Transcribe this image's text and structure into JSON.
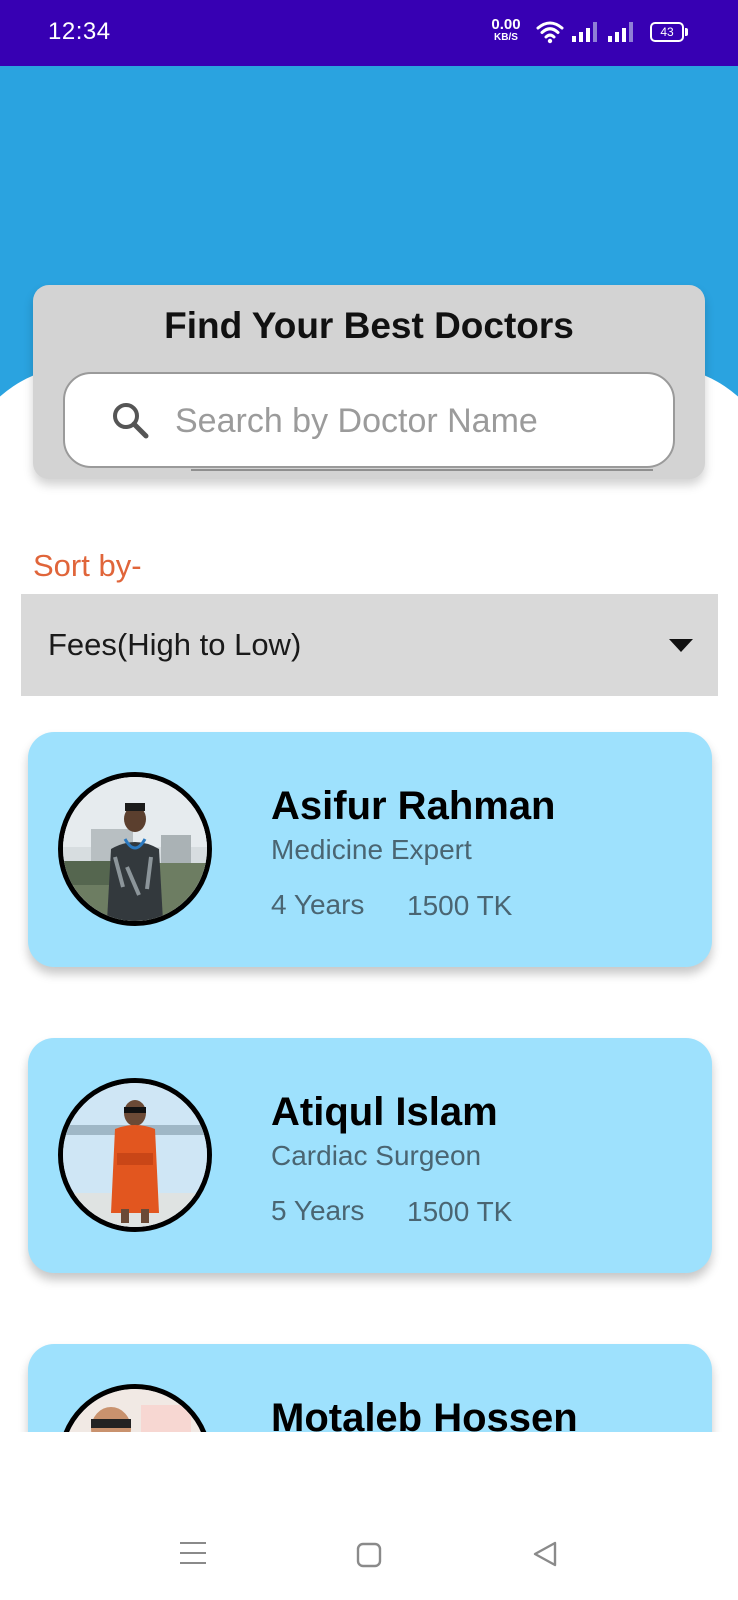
{
  "status_bar": {
    "time": "12:34",
    "net_speed_value": "0.00",
    "net_speed_unit": "KB/S",
    "battery": "43"
  },
  "search": {
    "title": "Find Your Best Doctors",
    "placeholder": "Search by Doctor Name"
  },
  "sort": {
    "label": "Sort by-",
    "selected": "Fees(High to Low)"
  },
  "doctors": [
    {
      "name": "Asifur Rahman",
      "specialty": "Medicine Expert",
      "experience": "4 Years",
      "fee": "1500 TK"
    },
    {
      "name": "Atiqul Islam",
      "specialty": "Cardiac Surgeon",
      "experience": "5 Years",
      "fee": "1500 TK"
    },
    {
      "name": "Motaleb Hossen"
    }
  ],
  "colors": {
    "status_bar": "#3700b3",
    "hero": "#2aa3e0",
    "card": "#9ee1fd",
    "sort_label": "#e0653a"
  },
  "icons": {
    "search": "search-icon",
    "dropdown": "chevron-down-icon",
    "nav": [
      "menu-icon",
      "home-square-icon",
      "back-triangle-icon"
    ]
  }
}
